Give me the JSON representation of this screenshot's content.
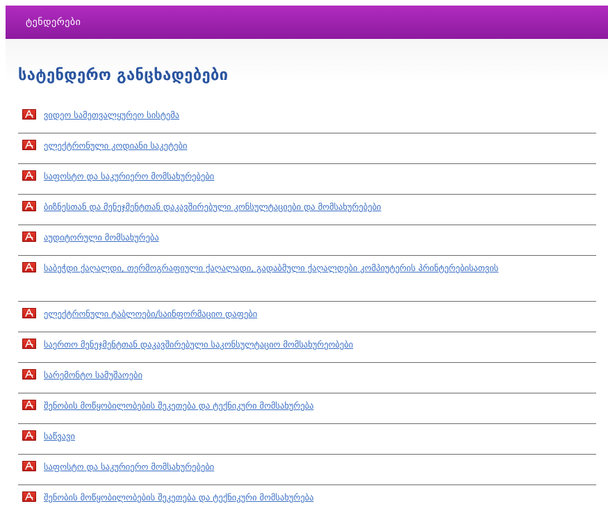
{
  "header": {
    "title": "ტენდერები"
  },
  "page": {
    "heading": "სატენდერო განცხადებები"
  },
  "tenders": [
    {
      "label": "ვიდეო სამეთვალყურეო სისტემა"
    },
    {
      "label": "ელექტრონული კოდიანი საკეტები"
    },
    {
      "label": "საფოსტო და საკურიერო მომსახურებები"
    },
    {
      "label": "ბიზნესთან და მენეჯმენტთან დაკავშირებული კონსულტაციები და მომსახურებები"
    },
    {
      "label": "აუდიტორული მომსახურება"
    },
    {
      "label": "საბეჭდი ქაღალდი, თერმოგრაფიული ქაღალადი, გადაბმული ქაღალდები კომპიუტერის პრინტერებისათვის"
    },
    {
      "label": "ელექტრონული ტაბლოები/საინფორმაციო დაფები"
    },
    {
      "label": "საერთო მენეჯმენტთან დაკავშირებული საკონსულტაციო მომსახურეობები"
    },
    {
      "label": "სარემონტო სამუშაოები"
    },
    {
      "label": "შენობის მოწყობილობების შეკეთება და ტექნიკური მომსახურება"
    },
    {
      "label": "საწვავი"
    },
    {
      "label": "საფოსტო და საკურიერო მომსახურებები"
    },
    {
      "label": "შენობის მოწყობილობების შეკეთება და ტექნიკური მომსახურება"
    }
  ],
  "icons": {
    "document": "pdf-icon"
  },
  "colors": {
    "header_bar": "#9d22ad",
    "heading": "#2a55a0",
    "link": "#3a6fc4",
    "pdf_icon": "#d42a1f"
  }
}
